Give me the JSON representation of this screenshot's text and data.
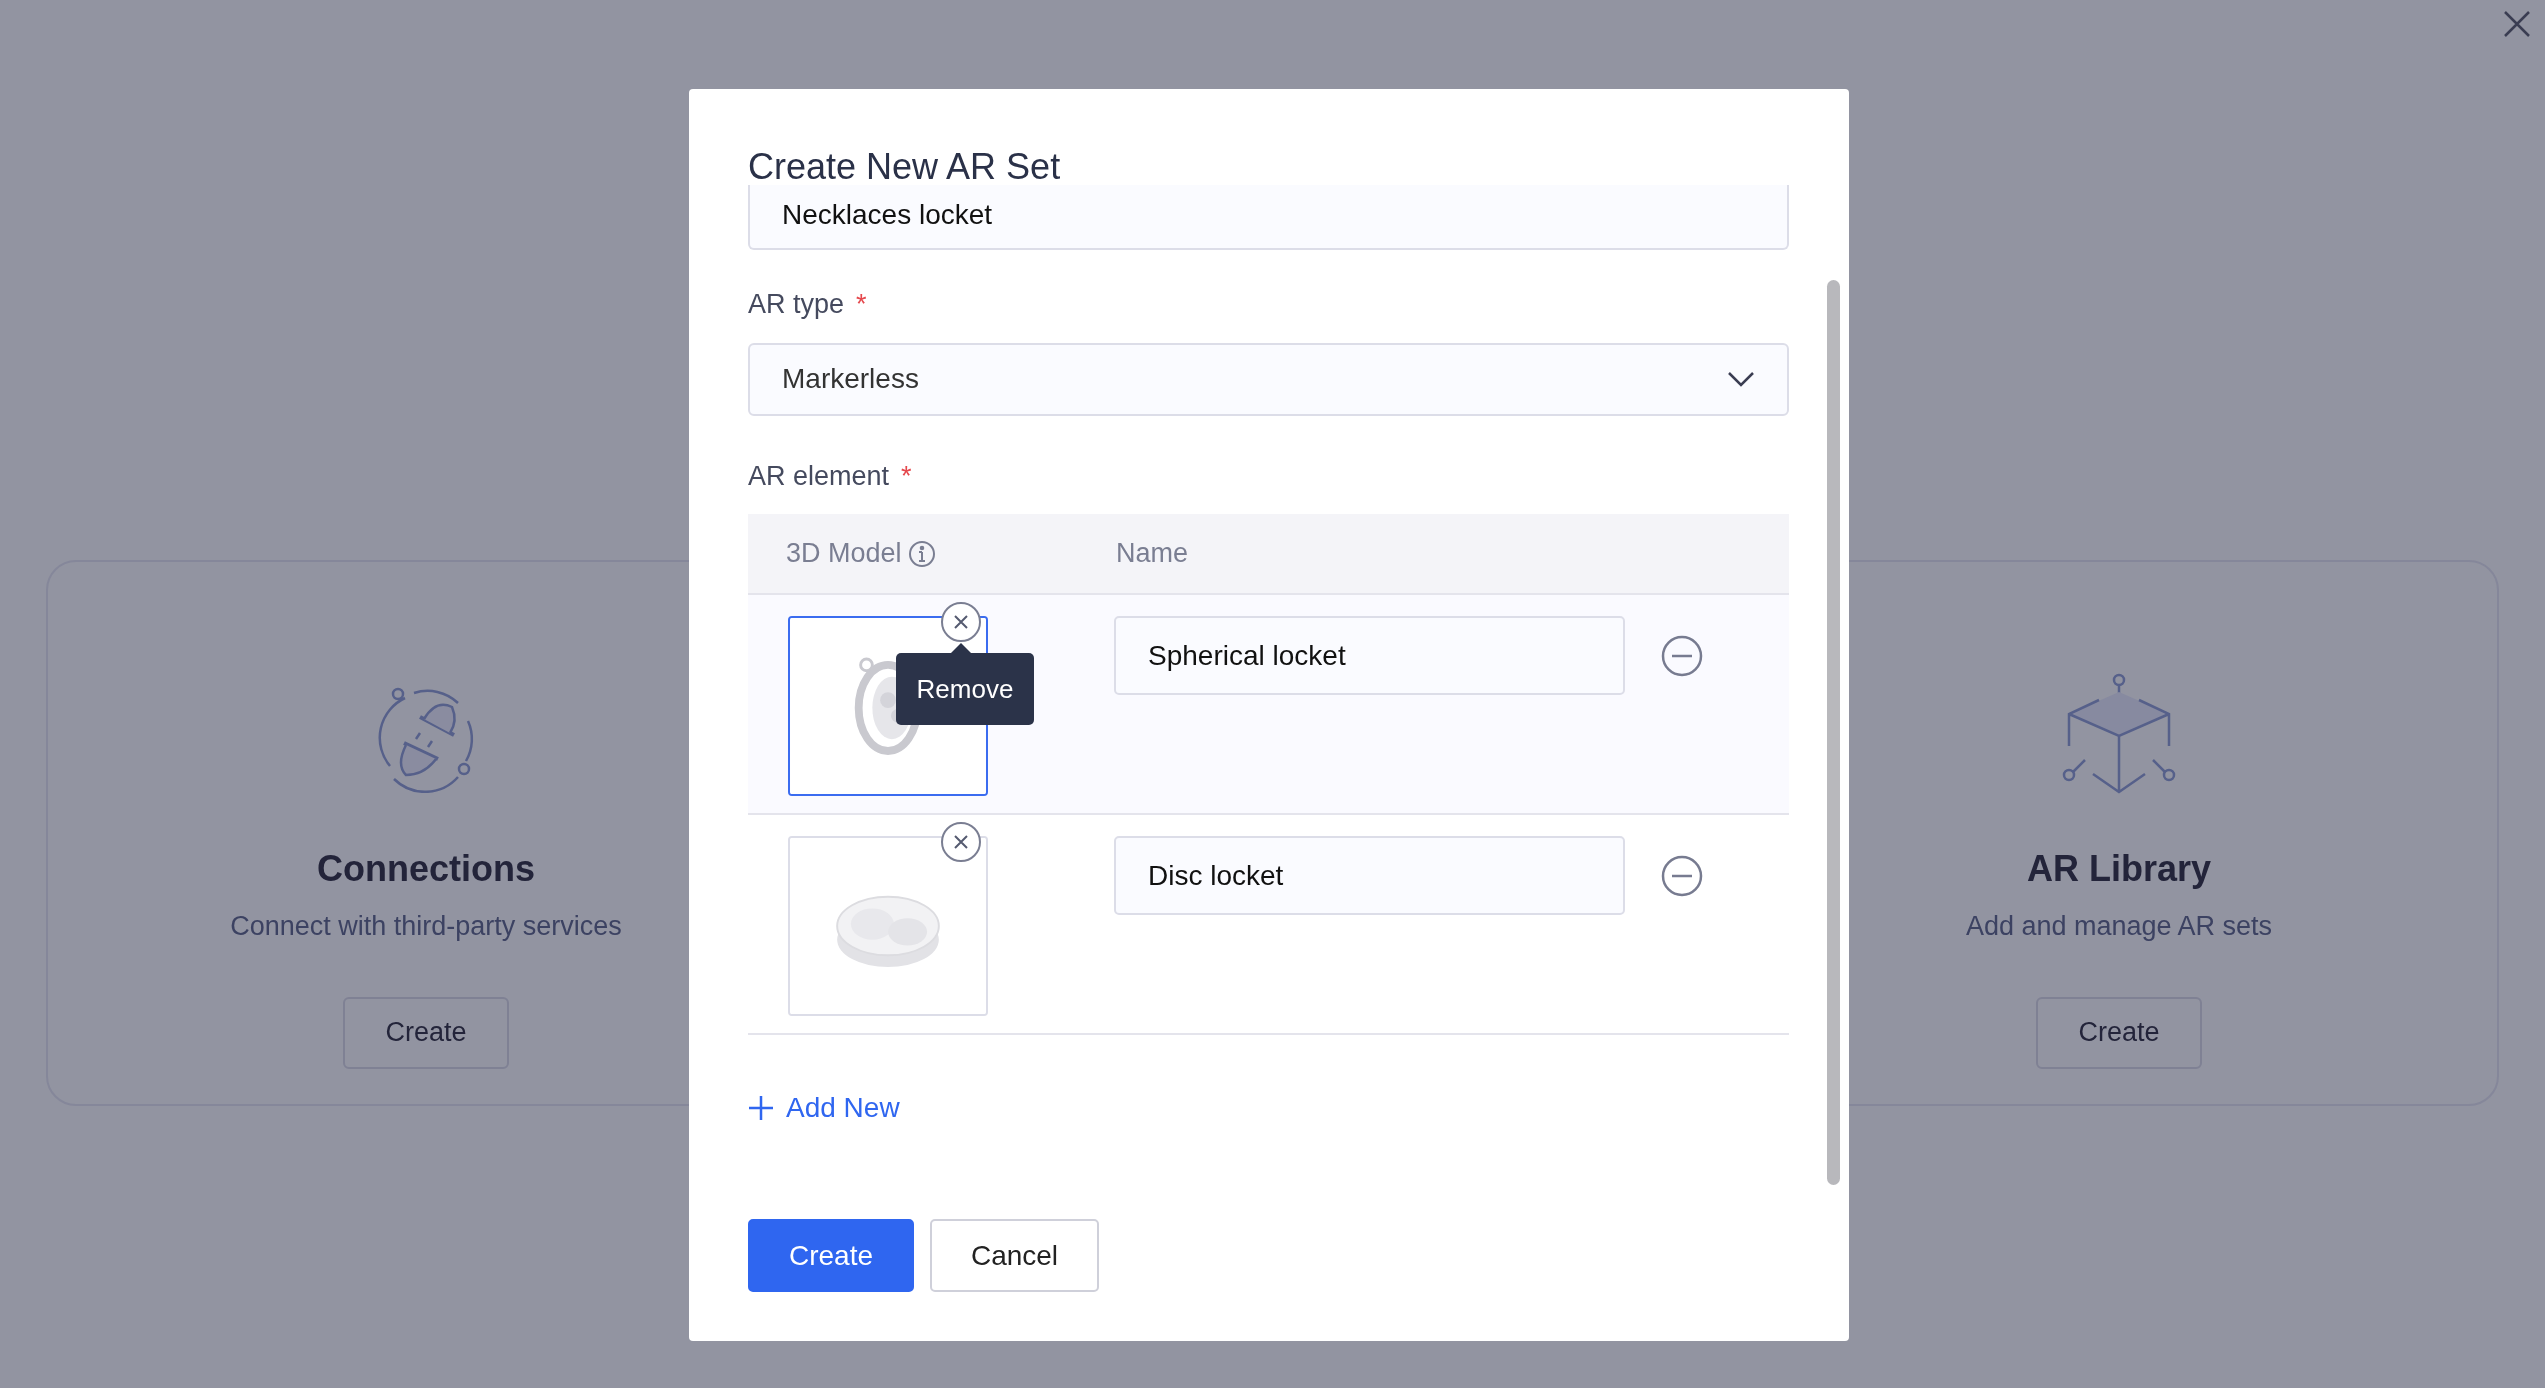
{
  "background_cards": [
    {
      "kind": "plug",
      "title": "Connections",
      "description": "Connect with third-party services",
      "button": "Create"
    },
    {
      "kind": "cube",
      "title": "AR Library",
      "description": "Add and manage AR sets",
      "button": "Create"
    }
  ],
  "dialog": {
    "title": "Create New AR Set",
    "name_field": {
      "value": "Necklaces locket"
    },
    "ar_type": {
      "label": "AR type",
      "required_mark": "*",
      "value": "Markerless"
    },
    "ar_element": {
      "label": "AR element",
      "required_mark": "*",
      "columns": [
        "3D Model",
        "Name"
      ],
      "rows": [
        {
          "name": "Spherical locket",
          "selected": true,
          "tooltip": "Remove"
        },
        {
          "name": "Disc locket",
          "selected": false
        }
      ]
    },
    "add_new": "Add New",
    "buttons": [
      {
        "label": "Create",
        "kind": "primary"
      },
      {
        "label": "Cancel",
        "kind": "secondary"
      }
    ]
  }
}
